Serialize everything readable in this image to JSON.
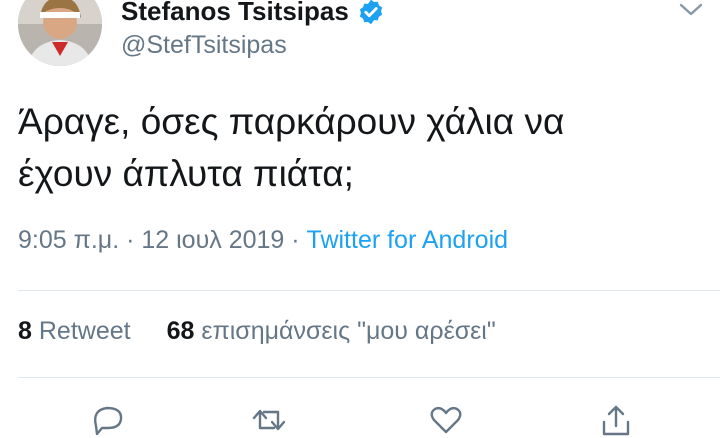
{
  "user": {
    "display_name": "Stefanos Tsitsipas",
    "handle": "@StefTsitsipas",
    "verified": true
  },
  "tweet": {
    "text_line_1": "Άραγε, όσες παρκάρουν χάλια να",
    "text_line_2": "έχουν άπλυτα πιάτα;"
  },
  "meta": {
    "time": "9:05 π.μ.",
    "separator_1": " · ",
    "date": "12 ιουλ 2019",
    "separator_2": " · ",
    "source": "Twitter for Android"
  },
  "stats": {
    "retweet_count": "8",
    "retweet_label": "Retweet",
    "like_count": "68",
    "like_label": "επισημάνσεις \"μου αρέσει\""
  },
  "icons": {
    "verified": "verified-badge-icon",
    "menu": "chevron-down-icon",
    "reply": "reply-icon",
    "retweet": "retweet-icon",
    "like": "heart-icon",
    "share": "share-icon"
  },
  "colors": {
    "accent": "#1da1f2",
    "text": "#14171a",
    "muted": "#657786",
    "divider": "#e1e8ed"
  }
}
